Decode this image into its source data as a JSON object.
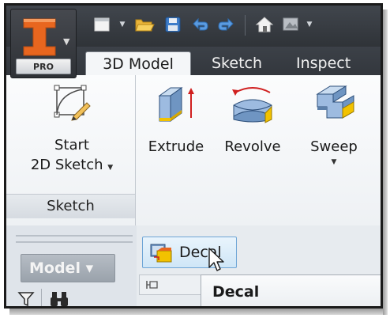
{
  "app": {
    "edition_label": "PRO",
    "logo_letter": "I"
  },
  "quick_access": {
    "icons": [
      "new-document-icon",
      "open-folder-icon",
      "save-icon",
      "undo-icon",
      "redo-icon",
      "home-icon",
      "appearance-icon"
    ]
  },
  "tabs": [
    {
      "label": "3D Model",
      "active": true
    },
    {
      "label": "Sketch",
      "active": false
    },
    {
      "label": "Inspect",
      "active": false
    }
  ],
  "ribbon": {
    "sketch_group": {
      "start_sketch_line1": "Start",
      "start_sketch_line2": "2D Sketch",
      "footer_label": "Sketch"
    },
    "create_group": {
      "extrude_label": "Extrude",
      "revolve_label": "Revolve",
      "sweep_label": "Sweep"
    }
  },
  "browser": {
    "model_tab_label": "Model ▾",
    "tool_icons": [
      "filter-icon",
      "binoculars-icon"
    ]
  },
  "panel": {
    "decal_button_label": "Decal",
    "tooltip_title": "Decal"
  },
  "colors": {
    "titlebar": "#33373d",
    "accent_orange": "#e8661f",
    "selection_blue": "#cfe6f7"
  }
}
